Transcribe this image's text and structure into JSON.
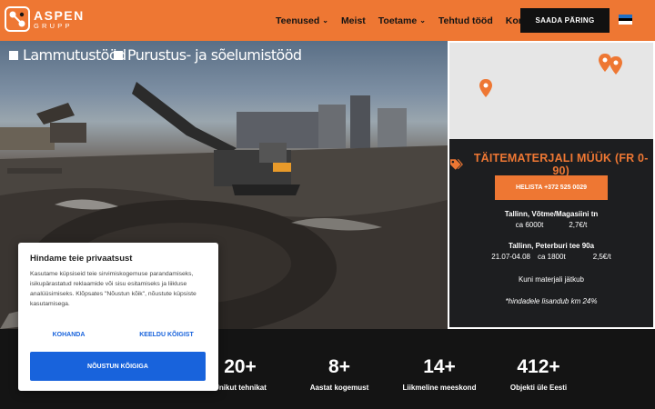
{
  "header": {
    "logo_name": "ASPEN",
    "logo_sub": "GRUPP",
    "nav": [
      {
        "label": "Teenused",
        "dropdown": true
      },
      {
        "label": "Meist",
        "dropdown": false
      },
      {
        "label": "Toetame",
        "dropdown": true
      },
      {
        "label": "Tehtud tööd",
        "dropdown": false
      },
      {
        "label": "Kontakt",
        "dropdown": false
      }
    ],
    "cta_label": "SAADA PÄRING",
    "accent": "#ee7733"
  },
  "hero": {
    "categories": [
      "Lammutustööd",
      "Purustus- ja sõelumistööd"
    ]
  },
  "panel": {
    "title": "TÄITEMATERJALI MÜÜK (FR 0-90)",
    "call_label": "HELISTA +372 525 0029",
    "locations": [
      {
        "name": "Tallinn, Võtme/Magasiini tn",
        "dates": "",
        "amount": "ca 6000t",
        "price": "2,7€/t"
      },
      {
        "name": "Tallinn, Peterburi tee 90a",
        "dates": "21.07-04.08",
        "amount": "ca 1800t",
        "price": "2,5€/t"
      }
    ],
    "ask_text": "Kuni materjali jätkub",
    "vat_note": "*hindadele lisandub km 24%"
  },
  "stats": [
    {
      "value": "20+",
      "label": "Unikut tehnikat"
    },
    {
      "value": "8+",
      "label": "Aastat kogemust"
    },
    {
      "value": "14+",
      "label": "Liikmeline meeskond"
    },
    {
      "value": "412+",
      "label": "Objekti üle Eesti"
    }
  ],
  "cookie": {
    "title": "Hindame teie privaatsust",
    "text": "Kasutame küpsiseid teie sirvimiskogemuse parandamiseks, isikupärastatud reklaamide või sisu esitamiseks ja liikluse analüüsimiseks. Klõpsates \"Nõustun kõik\", nõustute küpsiste kasutamisega.",
    "customize_label": "KOHANDA",
    "reject_label": "KEELDU KÕIGIST",
    "accept_label": "NÕUSTUN KÕIGIGA",
    "button_color": "#1863dc"
  }
}
